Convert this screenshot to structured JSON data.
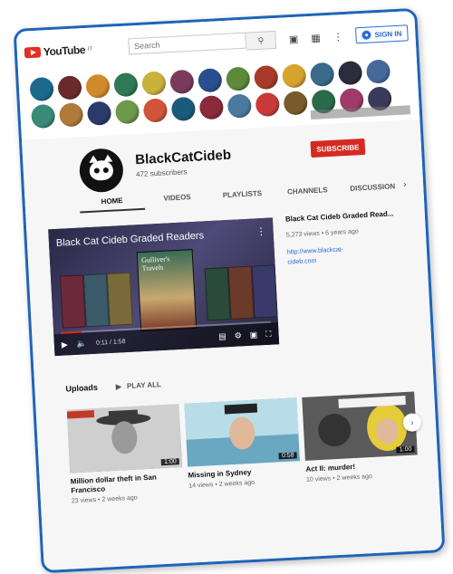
{
  "app": {
    "logo_text": "YouTube",
    "logo_suffix": "IT"
  },
  "header": {
    "search_placeholder": "Search",
    "search_icon": "search-icon",
    "video_icon": "video-camera-icon",
    "apps_icon": "apps-grid-icon",
    "more_icon": "more-vert-icon",
    "signin_label": "SIGN IN"
  },
  "banner": {
    "bubble_colors": [
      "#1b6a8e",
      "#6b2a2a",
      "#d08a2c",
      "#2d7a55",
      "#c8b23a",
      "#7a3a5c",
      "#2a4f8e",
      "#5a8a3a",
      "#a83a2a",
      "#d6a32c",
      "#3a6a8a",
      "#2c2c3c",
      "#456a9a",
      "#3a8a7a",
      "#b07a3a",
      "#2a3a6a",
      "#6a9a4a",
      "#d0553a",
      "#1a5a7a",
      "#8a2a3a",
      "#4a7aa0",
      "#c93a3a",
      "#7a5a2a",
      "#2a6a4a",
      "#a03a6a",
      "#3a3a5a"
    ],
    "link_overlay": ""
  },
  "channel": {
    "name": "BlackCatCideb",
    "subscribers": "472 subscribers",
    "subscribe_label": "SUBSCRIBE",
    "tabs": [
      "HOME",
      "VIDEOS",
      "PLAYLISTS",
      "CHANNELS",
      "DISCUSSION"
    ],
    "active_tab": "HOME"
  },
  "featured": {
    "video_title": "Black Cat Cideb Graded Readers",
    "book_title": "Gulliver's Travels",
    "time_label": "0:11 / 1:58",
    "progress": 0.1,
    "info_title": "Black Cat Cideb Graded Read...",
    "info_meta": "5,273 views • 6 years ago",
    "info_link": "http://www.blackcat-cideb.com"
  },
  "uploads": {
    "title": "Uploads",
    "play_all": "PLAY ALL",
    "items": [
      {
        "title": "Million dollar theft in San Francisco",
        "meta": "23 views • 2 weeks ago",
        "duration": "1:00"
      },
      {
        "title": "Missing in Sydney",
        "meta": "14 views • 2 weeks ago",
        "duration": "0:58"
      },
      {
        "title": "Act II: murder!",
        "meta": "10 views • 2 weeks ago",
        "duration": "1:00"
      }
    ]
  }
}
